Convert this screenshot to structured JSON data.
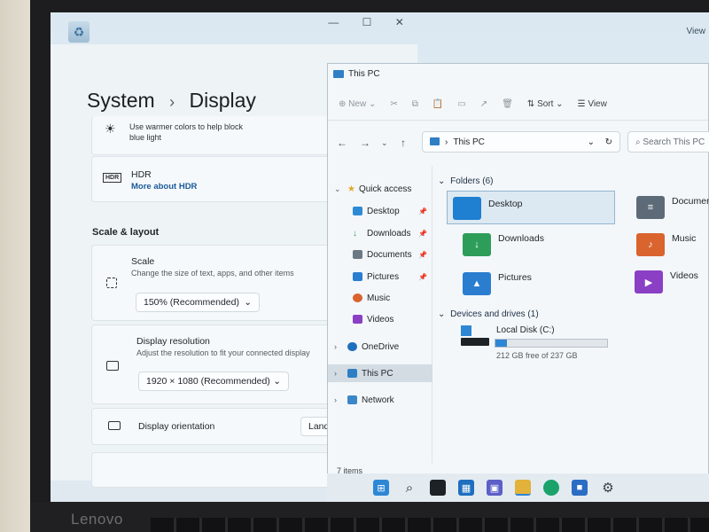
{
  "brand": "Lenovo",
  "settings": {
    "breadcrumb_root": "System",
    "breadcrumb_page": "Display",
    "night_light": {
      "desc": "Use warmer colors to help block blue light"
    },
    "hdr": {
      "badge": "HDR",
      "title": "HDR",
      "link": "More about HDR"
    },
    "section_scale": "Scale & layout",
    "scale": {
      "title": "Scale",
      "desc": "Change the size of text, apps, and other items",
      "value": "150% (Recommended)"
    },
    "resolution": {
      "title": "Display resolution",
      "desc": "Adjust the resolution to fit your connected display",
      "value": "1920 × 1080 (Recommended)"
    },
    "orientation": {
      "title": "Display orientation",
      "value": "Land"
    }
  },
  "explorer": {
    "title": "This PC",
    "toolbar": {
      "new": "New",
      "sort": "Sort",
      "view": "View"
    },
    "address": "This PC",
    "search_placeholder": "Search This PC",
    "nav": {
      "quick_access": "Quick access",
      "desktop": "Desktop",
      "downloads": "Downloads",
      "documents": "Documents",
      "pictures": "Pictures",
      "music": "Music",
      "videos": "Videos",
      "onedrive": "OneDrive",
      "this_pc": "This PC",
      "network": "Network"
    },
    "folders_header": "Folders (6)",
    "folders": {
      "desktop": "Desktop",
      "documents": "Documen",
      "downloads": "Downloads",
      "music": "Music",
      "pictures": "Pictures",
      "videos": "Videos"
    },
    "devices_header": "Devices and drives (1)",
    "drive": {
      "name": "Local Disk (C:)",
      "free": "212 GB free of 237 GB",
      "used_fraction": 0.105
    },
    "status": "7 items"
  },
  "colors": {
    "accent": "#2e87d5",
    "folder_blue": "#1f7fd1",
    "folder_green": "#2f9d5a",
    "folder_orange": "#d9642e",
    "folder_purple": "#8a3fc4"
  }
}
